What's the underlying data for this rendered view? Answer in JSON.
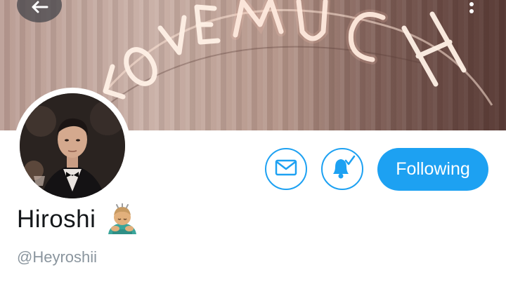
{
  "banner": {
    "neon_text": "LOVE MUCH",
    "image_icon": "neon-sign-banner"
  },
  "header": {
    "back_icon": "arrow-left-icon",
    "more_icon": "more-vertical-icon"
  },
  "profile": {
    "avatar_icon": "profile-photo",
    "display_name": "Hiroshi",
    "emoji_icon": "person-bowing-emoji",
    "handle": "@Heyroshii"
  },
  "actions": {
    "message_icon": "envelope-icon",
    "notify_icon": "bell-check-icon",
    "follow_label": "Following"
  },
  "colors": {
    "accent": "#1da1f2",
    "name_text": "#14171a",
    "handle_text": "#8a959e"
  }
}
